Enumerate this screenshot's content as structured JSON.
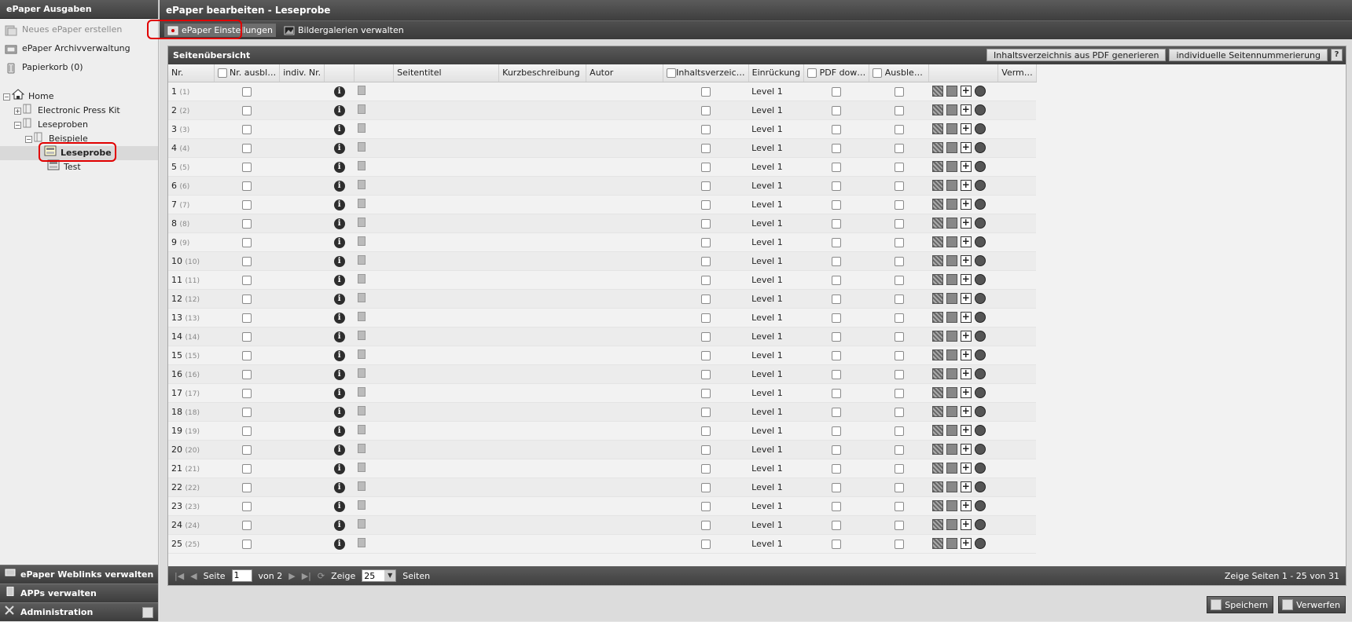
{
  "left": {
    "header": "ePaper Ausgaben",
    "menu": [
      {
        "label": "Neues ePaper erstellen",
        "icon": "new-document-icon",
        "disabled": true
      },
      {
        "label": "ePaper Archivverwaltung",
        "icon": "archive-icon",
        "disabled": false
      },
      {
        "label": "Papierkorb (0)",
        "icon": "trash-icon",
        "disabled": false
      }
    ],
    "tree": {
      "home": "Home",
      "epk": "Electronic Press Kit",
      "leseproben": "Leseproben",
      "beispiele": "Beispiele",
      "leseprobe": "Leseprobe",
      "test": "Test"
    },
    "bottom": [
      {
        "label": "ePaper Weblinks verwalten",
        "icon": "weblinks-icon"
      },
      {
        "label": "APPs verwalten",
        "icon": "apps-icon"
      },
      {
        "label": "Administration",
        "icon": "tools-icon"
      }
    ]
  },
  "right": {
    "header": "ePaper bearbeiten - Leseprobe",
    "tabs": {
      "settings": "ePaper Einstellungen",
      "galleries": "Bildergalerien verwalten"
    },
    "panel": {
      "title": "Seitenübersicht",
      "btn_toc": "Inhaltsverzeichnis aus PDF generieren",
      "btn_numbering": "individuelle Seitennummerierung",
      "help": "?"
    },
    "columns": {
      "nr": "Nr.",
      "hide_nr": "Nr. ausbl…",
      "indiv": "indiv. Nr.",
      "title": "Seitentitel",
      "short": "Kurzbeschreibung",
      "author": "Autor",
      "toc": "Inhaltsverzeic…",
      "indent": "Einrückung",
      "pdf": "PDF dow…",
      "hide": "Ausble…",
      "link": "Verm…"
    },
    "rows": [
      {
        "nr": "1",
        "sub": "(1)",
        "level": "Level 1"
      },
      {
        "nr": "2",
        "sub": "(2)",
        "level": "Level 1"
      },
      {
        "nr": "3",
        "sub": "(3)",
        "level": "Level 1"
      },
      {
        "nr": "4",
        "sub": "(4)",
        "level": "Level 1"
      },
      {
        "nr": "5",
        "sub": "(5)",
        "level": "Level 1"
      },
      {
        "nr": "6",
        "sub": "(6)",
        "level": "Level 1"
      },
      {
        "nr": "7",
        "sub": "(7)",
        "level": "Level 1"
      },
      {
        "nr": "8",
        "sub": "(8)",
        "level": "Level 1"
      },
      {
        "nr": "9",
        "sub": "(9)",
        "level": "Level 1"
      },
      {
        "nr": "10",
        "sub": "(10)",
        "level": "Level 1"
      },
      {
        "nr": "11",
        "sub": "(11)",
        "level": "Level 1"
      },
      {
        "nr": "12",
        "sub": "(12)",
        "level": "Level 1"
      },
      {
        "nr": "13",
        "sub": "(13)",
        "level": "Level 1"
      },
      {
        "nr": "14",
        "sub": "(14)",
        "level": "Level 1"
      },
      {
        "nr": "15",
        "sub": "(15)",
        "level": "Level 1"
      },
      {
        "nr": "16",
        "sub": "(16)",
        "level": "Level 1"
      },
      {
        "nr": "17",
        "sub": "(17)",
        "level": "Level 1"
      },
      {
        "nr": "18",
        "sub": "(18)",
        "level": "Level 1"
      },
      {
        "nr": "19",
        "sub": "(19)",
        "level": "Level 1"
      },
      {
        "nr": "20",
        "sub": "(20)",
        "level": "Level 1"
      },
      {
        "nr": "21",
        "sub": "(21)",
        "level": "Level 1"
      },
      {
        "nr": "22",
        "sub": "(22)",
        "level": "Level 1"
      },
      {
        "nr": "23",
        "sub": "(23)",
        "level": "Level 1"
      },
      {
        "nr": "24",
        "sub": "(24)",
        "level": "Level 1"
      },
      {
        "nr": "25",
        "sub": "(25)",
        "level": "Level 1"
      }
    ],
    "pager": {
      "page_label": "Seite",
      "page_value": "1",
      "of": "von 2",
      "show_label": "Zeige",
      "per_page": "25",
      "pages_label": "Seiten",
      "summary": "Zeige Seiten 1 - 25 von 31"
    },
    "buttons": {
      "save": "Speichern",
      "discard": "Verwerfen"
    }
  }
}
